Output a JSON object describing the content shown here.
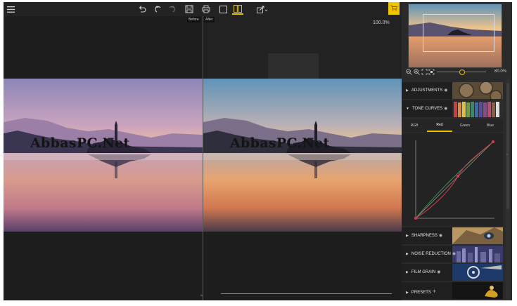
{
  "toolbar": {
    "menu_icon": "hamburger-icon",
    "undo_icon": "undo-icon",
    "undo_step_icon": "undo-step-icon",
    "redo_icon": "redo-icon",
    "save_icon": "save-icon",
    "print_icon": "print-icon",
    "single_view_icon": "single-view-icon",
    "split_view_icon": "split-view-icon",
    "share_icon": "share-icon",
    "before_label": "Before",
    "after_label": "After",
    "cart_icon": "cart-icon",
    "accent_color": "#e8c000"
  },
  "canvas": {
    "zoom_readout": "100.0%",
    "watermark_left": "AbbasPC.Net",
    "watermark_right": "AbbasPC.Net"
  },
  "panel": {
    "zoom_out_icon": "zoom-out-icon",
    "zoom_in_icon": "zoom-in-icon",
    "fit_icon": "fit-icon",
    "fill_icon": "fill-icon",
    "zoom_percent": "80.0%",
    "zoom_level": 0.5,
    "sections": {
      "adjustments": "ADJUSTMENTS",
      "tone_curves": "TONE CURVES",
      "sharpness": "SHARPNESS",
      "noise_reduction": "NOISE REDUCTION",
      "film_grain": "FILM GRAIN",
      "presets": "PRESETS"
    },
    "channels": [
      "RGB",
      "Red",
      "Green",
      "Blue"
    ],
    "active_channel": "Red"
  }
}
